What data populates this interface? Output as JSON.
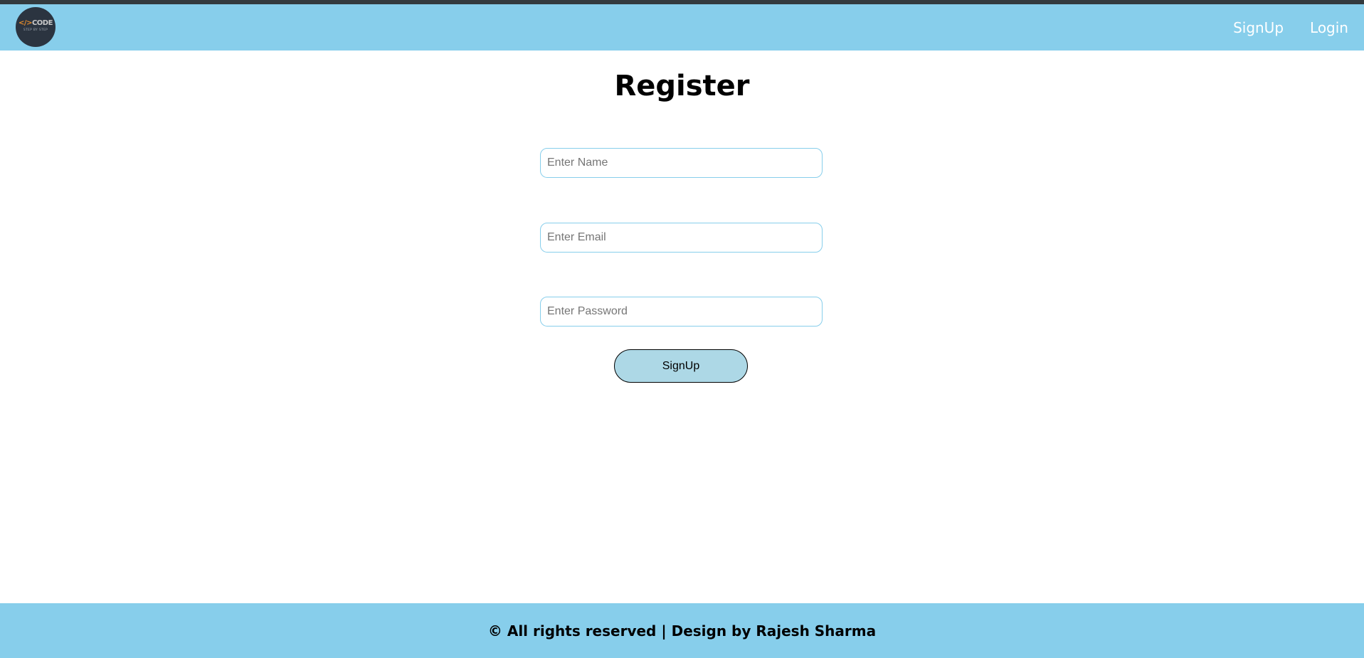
{
  "navbar": {
    "logo_text": "</>CODE",
    "logo_subtext": "STEP BY STEP",
    "links": [
      {
        "label": "SignUp",
        "icon": "none"
      },
      {
        "label": "Login",
        "icon": "none"
      }
    ],
    "background_color": "#87ceeb"
  },
  "form": {
    "title": "Register",
    "name_placeholder": "Enter Name",
    "email_placeholder": "Enter Email",
    "password_placeholder": "Enter Password",
    "name_value": "",
    "email_value": "",
    "password_value": "",
    "submit_label": "SignUp",
    "button_color": "#add8e6",
    "field_border_color": "#87ceeb"
  },
  "footer": {
    "text": "© All rights reserved | Design by Rajesh Sharma",
    "background_color": "#87ceeb"
  }
}
